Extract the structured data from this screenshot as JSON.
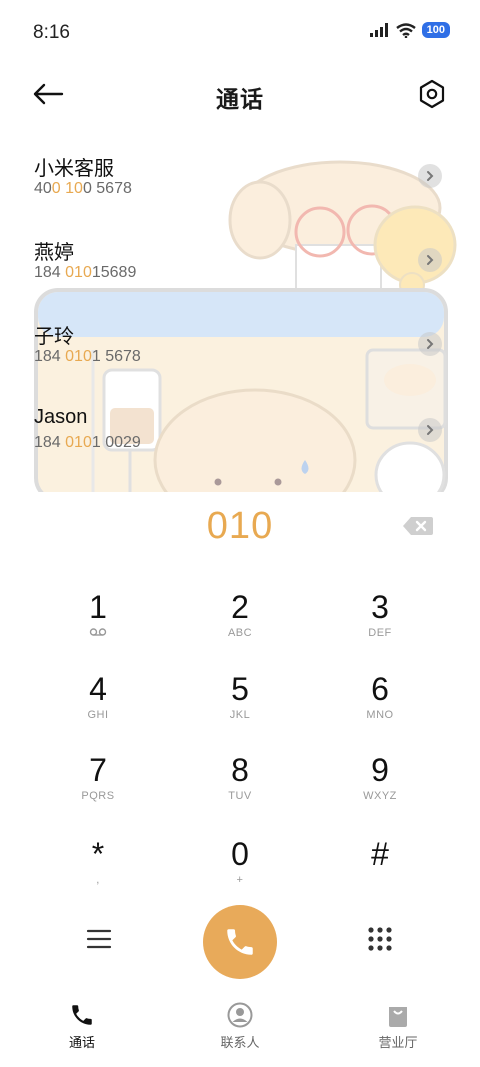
{
  "status_bar": {
    "time": "8:16",
    "battery": "100"
  },
  "header": {
    "title": "通话"
  },
  "call_log": [
    {
      "name": "小米客服",
      "num_pre": "40",
      "num_hl": "0 10",
      "num_post": "0 5678"
    },
    {
      "name": "燕婷",
      "num_pre": "184 ",
      "num_hl": "010",
      "num_post": "15689"
    },
    {
      "name": "子玲",
      "num_pre": "184 ",
      "num_hl": "010",
      "num_post": "1 5678"
    },
    {
      "name": "Jason",
      "num_pre": "184 ",
      "num_hl": "010",
      "num_post": "1 0029"
    }
  ],
  "dial": {
    "number": "010"
  },
  "keypad": [
    {
      "digit": "1",
      "letters": ""
    },
    {
      "digit": "2",
      "letters": "ABC"
    },
    {
      "digit": "3",
      "letters": "DEF"
    },
    {
      "digit": "4",
      "letters": "GHI"
    },
    {
      "digit": "5",
      "letters": "JKL"
    },
    {
      "digit": "6",
      "letters": "MNO"
    },
    {
      "digit": "7",
      "letters": "PQRS"
    },
    {
      "digit": "8",
      "letters": "TUV"
    },
    {
      "digit": "9",
      "letters": "WXYZ"
    },
    {
      "digit": "*",
      "letters": ","
    },
    {
      "digit": "0",
      "letters": "+"
    },
    {
      "digit": "#",
      "letters": ""
    }
  ],
  "nav": {
    "calls": "通话",
    "contacts": "联系人",
    "store": "营业厅"
  },
  "colors": {
    "accent": "#e8a951",
    "call_button": "#e8aa5a",
    "battery": "#2f6fe6"
  },
  "icons": {
    "voicemail": "voicemail-icon",
    "back": "arrow-left-icon",
    "settings": "hexagon-settings-icon",
    "backspace": "backspace-icon",
    "menu": "menu-icon",
    "call": "phone-icon",
    "dialpad": "dialpad-icon"
  }
}
